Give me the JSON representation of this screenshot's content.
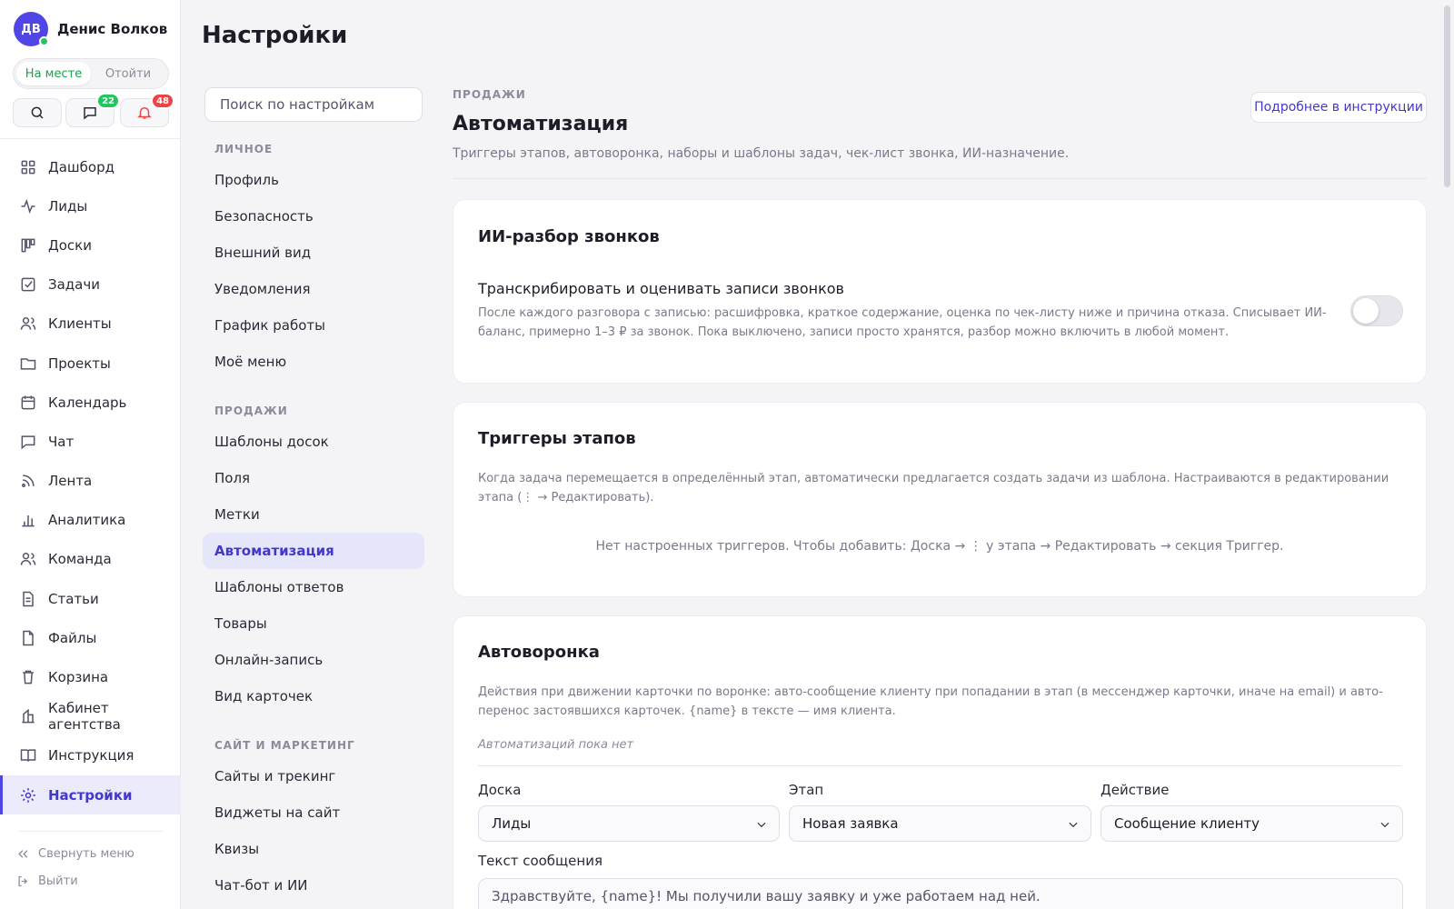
{
  "user": {
    "initials": "ДВ",
    "name": "Денис Волков"
  },
  "status": {
    "present": "На месте",
    "away": "Отойти"
  },
  "badges": {
    "chat": "22",
    "notifications": "48"
  },
  "nav": {
    "items": [
      {
        "label": "Дашборд",
        "icon": "dashboard-icon"
      },
      {
        "label": "Лиды",
        "icon": "activity-icon"
      },
      {
        "label": "Доски",
        "icon": "kanban-icon"
      },
      {
        "label": "Задачи",
        "icon": "checkbox-icon"
      },
      {
        "label": "Клиенты",
        "icon": "users-icon"
      },
      {
        "label": "Проекты",
        "icon": "folder-icon"
      },
      {
        "label": "Календарь",
        "icon": "calendar-icon"
      },
      {
        "label": "Чат",
        "icon": "chat-icon"
      },
      {
        "label": "Лента",
        "icon": "rss-icon"
      },
      {
        "label": "Аналитика",
        "icon": "bar-chart-icon"
      },
      {
        "label": "Команда",
        "icon": "team-icon"
      },
      {
        "label": "Статьи",
        "icon": "document-icon"
      },
      {
        "label": "Файлы",
        "icon": "file-icon"
      },
      {
        "label": "Корзина",
        "icon": "trash-icon"
      },
      {
        "label": "Кабинет агентства",
        "icon": "building-icon"
      },
      {
        "label": "Инструкция",
        "icon": "book-icon"
      },
      {
        "label": "Настройки",
        "icon": "gear-icon"
      }
    ],
    "collapse": "Свернуть меню",
    "logout": "Выйти"
  },
  "page_title": "Настройки",
  "settings_search": {
    "placeholder": "Поиск по настройкам"
  },
  "settings_menu": {
    "personal": {
      "title": "ЛИЧНОЕ",
      "items": [
        "Профиль",
        "Безопасность",
        "Внешний вид",
        "Уведомления",
        "График работы",
        "Моё меню"
      ]
    },
    "sales": {
      "title": "ПРОДАЖИ",
      "items": [
        "Шаблоны досок",
        "Поля",
        "Метки",
        "Автоматизация",
        "Шаблоны ответов",
        "Товары",
        "Онлайн-запись",
        "Вид карточек"
      ]
    },
    "site": {
      "title": "САЙТ И МАРКЕТИНГ",
      "items": [
        "Сайты и трекинг",
        "Виджеты на сайт",
        "Квизы",
        "Чат-бот и ИИ"
      ]
    }
  },
  "section": {
    "kicker": "ПРОДАЖИ",
    "title": "Автоматизация",
    "description": "Триггеры этапов, автоворонка, наборы и шаблоны задач, чек-лист звонка, ИИ-назначение.",
    "docs_link": "Подробнее в инструкции"
  },
  "ai_card": {
    "title": "ИИ-разбор звонков",
    "row_title": "Транскрибировать и оценивать записи звонков",
    "row_desc": "После каждого разговора с записью: расшифровка, краткое содержание, оценка по чек-листу ниже и причина отказа. Списывает ИИ-баланс, примерно 1–3 ₽ за звонок. Пока выключено, записи просто хранятся, разбор можно включить в любой момент.",
    "enabled": false
  },
  "triggers_card": {
    "title": "Триггеры этапов",
    "desc": "Когда задача перемещается в определённый этап, автоматически предлагается создать задачи из шаблона. Настраиваются в редактировании этапа (⋮ → Редактировать).",
    "empty": "Нет настроенных триггеров. Чтобы добавить: Доска → ⋮ у этапа → Редактировать → секция Триггер."
  },
  "funnel_card": {
    "title": "Автоворонка",
    "desc": "Действия при движении карточки по воронке: авто-сообщение клиенту при попадании в этап (в мессенджер карточки, иначе на email) и авто-перенос застоявшихся карточек. {name} в тексте — имя клиента.",
    "empty": "Автоматизаций пока нет",
    "board_label": "Доска",
    "board_value": "Лиды",
    "stage_label": "Этап",
    "stage_value": "Новая заявка",
    "action_label": "Действие",
    "action_value": "Сообщение клиенту",
    "message_label": "Текст сообщения",
    "message_value": "Здравствуйте, {name}! Мы получили вашу заявку и уже работаем над ней."
  },
  "colors": {
    "accent": "#4f46e5",
    "active_bg": "#ebebfb",
    "online": "#22c55e",
    "alert": "#ef4444"
  }
}
